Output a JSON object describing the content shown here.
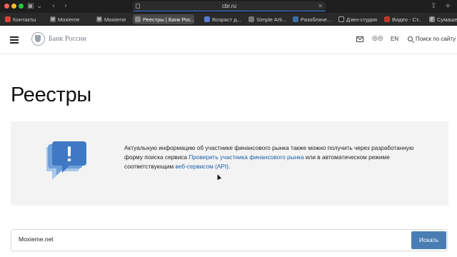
{
  "browser": {
    "url": "cbr.ru",
    "tabs": [
      {
        "label": "Контакты",
        "favicon": "red-bookmark-icon",
        "color": "#d4463b"
      },
      {
        "label": "Moxieme",
        "favicon": "letter-m-icon",
        "color": "#6b6b6b"
      },
      {
        "label": "Moxieme",
        "favicon": "letter-m-icon",
        "color": "#6b6b6b"
      },
      {
        "label": "Реестры | Банк Рос...",
        "favicon": "bank-emblem-icon",
        "color": "#8a8a8a",
        "active": true
      },
      {
        "label": "Возраст д...",
        "favicon": "document-icon",
        "color": "#5b7bd6"
      },
      {
        "label": "Simple Arti...",
        "favicon": "gear-icon",
        "color": "#777777"
      },
      {
        "label": "Разоблаче...",
        "favicon": "vk-icon",
        "color": "#3a6ea5"
      },
      {
        "label": "Дзен-студия",
        "favicon": "zen-icon",
        "color": "#222222"
      },
      {
        "label": "Видео - Ст...",
        "favicon": "video-icon",
        "color": "#c0392b"
      },
      {
        "label": "Сумашед...",
        "favicon": "letter-f-icon",
        "color": "#888888"
      }
    ]
  },
  "header": {
    "logo_text": "Банк России",
    "lang": "EN",
    "search_label": "Поиск по сайту"
  },
  "page": {
    "title": "Реестры"
  },
  "info": {
    "text_before": "Актуальную информацию об участнике финансового рынка также можно получить через разработанную форму поиска сервиса ",
    "link1": "Проверить участника финансового рынка",
    "text_middle": " или в автоматическом режиме соответствующим ",
    "link2": "веб-сервисом (API)",
    "text_after": "."
  },
  "search": {
    "value": "Moxieme.net",
    "button_label": "Искать"
  }
}
